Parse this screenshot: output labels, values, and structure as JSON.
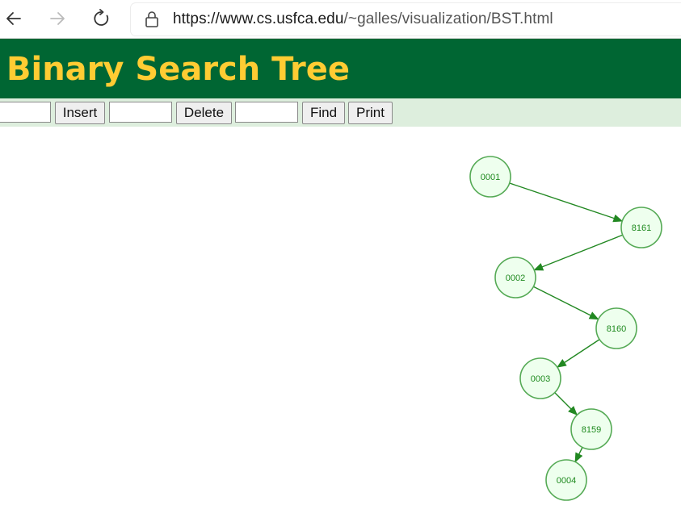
{
  "browser": {
    "url_host": "https://www.cs.usfca.edu",
    "url_path": "/~galles/visualization/BST.html",
    "back_icon": "arrow-left-icon",
    "forward_icon": "arrow-right-icon",
    "refresh_icon": "refresh-icon",
    "lock_icon": "lock-icon"
  },
  "header": {
    "title": "Binary Search Tree"
  },
  "controls": {
    "insert_value": "",
    "insert_label": "Insert",
    "delete_value": "",
    "delete_label": "Delete",
    "find_value": "",
    "find_label": "Find",
    "print_label": "Print"
  },
  "colors": {
    "header_bg": "#006633",
    "header_text": "#ffcc33",
    "controls_bg": "#ddeedd",
    "node_fill": "#eeffee",
    "node_stroke": "#55aa55",
    "edge": "#228822"
  },
  "tree": {
    "nodes": [
      {
        "id": "n1",
        "label": "0001"
      },
      {
        "id": "n2",
        "label": "8161"
      },
      {
        "id": "n3",
        "label": "0002"
      },
      {
        "id": "n4",
        "label": "8160"
      },
      {
        "id": "n5",
        "label": "0003"
      },
      {
        "id": "n6",
        "label": "8159"
      },
      {
        "id": "n7",
        "label": "0004"
      }
    ],
    "edges": [
      {
        "from": "n1",
        "to": "n2"
      },
      {
        "from": "n2",
        "to": "n3"
      },
      {
        "from": "n3",
        "to": "n4"
      },
      {
        "from": "n4",
        "to": "n5"
      },
      {
        "from": "n5",
        "to": "n6"
      },
      {
        "from": "n6",
        "to": "n7"
      }
    ]
  }
}
